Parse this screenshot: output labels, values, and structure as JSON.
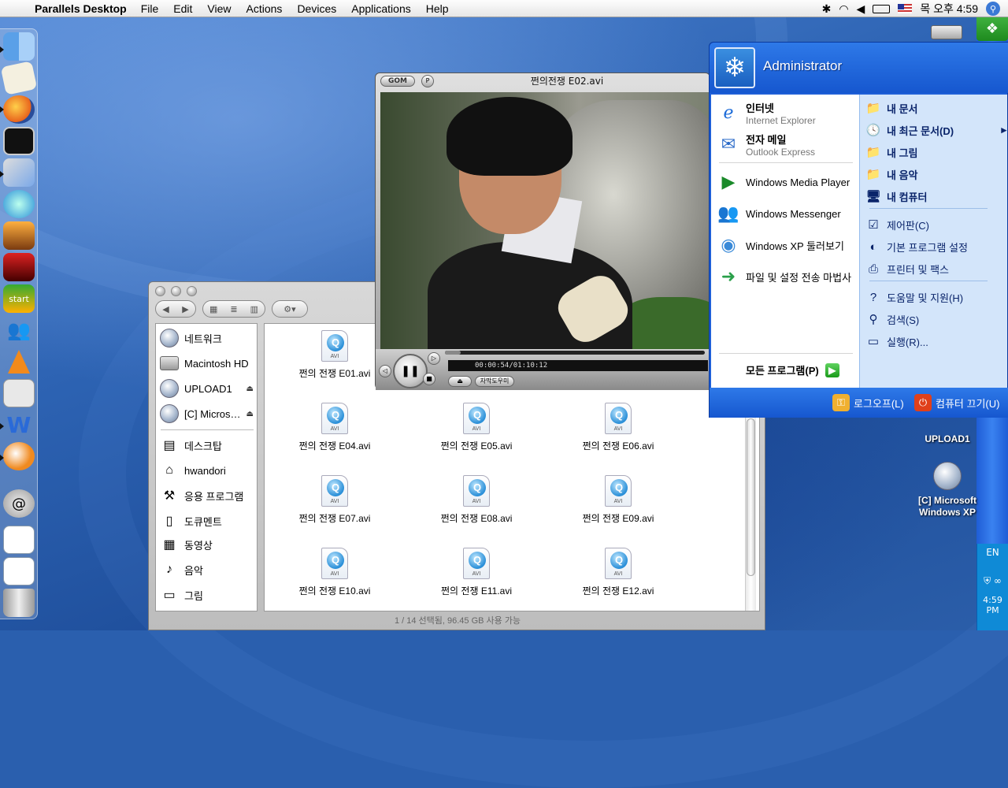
{
  "menubar": {
    "app": "Parallels Desktop",
    "items": [
      "File",
      "Edit",
      "View",
      "Actions",
      "Devices",
      "Applications",
      "Help"
    ],
    "clock": "목 오후 4:59"
  },
  "dock": {
    "items": [
      "finder-icon",
      "textedit-icon",
      "firefox-icon",
      "terminal-icon",
      "parallels-icon",
      "itunes-icon",
      "iphoto-icon",
      "dvd-player-icon",
      "msn-start-icon",
      "messenger-icon",
      "vlc-icon",
      "bootcamp-icon",
      "wmv-icon",
      "msn-icon",
      "mail-icon",
      "window-icon",
      "window-icon",
      "trash-icon"
    ]
  },
  "finder": {
    "sidebar": [
      {
        "label": "네트워크",
        "icon": "disk"
      },
      {
        "label": "Macintosh HD",
        "icon": "hd"
      },
      {
        "label": "UPLOAD1",
        "icon": "disk",
        "eject": "⏏"
      },
      {
        "label": "[C] Micros…",
        "icon": "disk",
        "eject": "⏏"
      },
      {
        "label": "데스크탑",
        "icon": "desktop"
      },
      {
        "label": "hwandori",
        "icon": "home"
      },
      {
        "label": "응용 프로그램",
        "icon": "apps"
      },
      {
        "label": "도큐멘트",
        "icon": "doc"
      },
      {
        "label": "동영상",
        "icon": "movie"
      },
      {
        "label": "음악",
        "icon": "music"
      },
      {
        "label": "그림",
        "icon": "picture"
      }
    ],
    "files": [
      "쩐의 전쟁 E01.avi",
      "쩐의 전쟁 E04.avi",
      "쩐의 전쟁 E05.avi",
      "쩐의 전쟁 E06.avi",
      "쩐의 전쟁 E07.avi",
      "쩐의 전쟁 E08.avi",
      "쩐의 전쟁 E09.avi",
      "쩐의 전쟁 E10.avi",
      "쩐의 전쟁 E11.avi",
      "쩐의 전쟁 E12.avi"
    ],
    "file_type": "AVI",
    "status": "1 / 14 선택됨, 96.45 GB 사용 가능"
  },
  "player": {
    "title": "쩐의전쟁 E02.avi",
    "logo": "GOM",
    "time": "00:00:54/01:10:12",
    "subtitle_btn": "자막도우미"
  },
  "startmenu": {
    "user": "Administrator",
    "left": [
      {
        "t1": "인터넷",
        "t2": "Internet Explorer",
        "bold": true
      },
      {
        "t1": "전자 메일",
        "t2": "Outlook Express",
        "bold": true
      },
      {
        "t1": "Windows Media Player"
      },
      {
        "t1": "Windows Messenger"
      },
      {
        "t1": "Windows XP 둘러보기"
      },
      {
        "t1": "파일 및 설정 전송 마법사"
      }
    ],
    "all_programs": "모든 프로그램(P)",
    "right": [
      {
        "label": "내 문서",
        "bold": true
      },
      {
        "label": "내 최근 문서(D)",
        "bold": true,
        "arrow": "▸"
      },
      {
        "label": "내 그림",
        "bold": true
      },
      {
        "label": "내 음악",
        "bold": true
      },
      {
        "label": "내 컴퓨터",
        "bold": true
      },
      {
        "label": "제어판(C)"
      },
      {
        "label": "기본 프로그램 설정"
      },
      {
        "label": "프린터 및 팩스"
      },
      {
        "label": "도움말 및 지원(H)"
      },
      {
        "label": "검색(S)"
      },
      {
        "label": "실행(R)..."
      }
    ],
    "logoff": "로그오프(L)",
    "shutdown": "컴퓨터 끄기(U)"
  },
  "desktop_icons": [
    {
      "label": "UPLOAD1"
    },
    {
      "label": "[C] Microsoft Windows XP"
    }
  ],
  "xp_tray": {
    "lang": "EN",
    "time": "4:59 PM"
  },
  "colors": {
    "xp_blue": "#1e5fd7",
    "menu_pane": "#d3e5fa",
    "desktop": "#2d63b3"
  }
}
